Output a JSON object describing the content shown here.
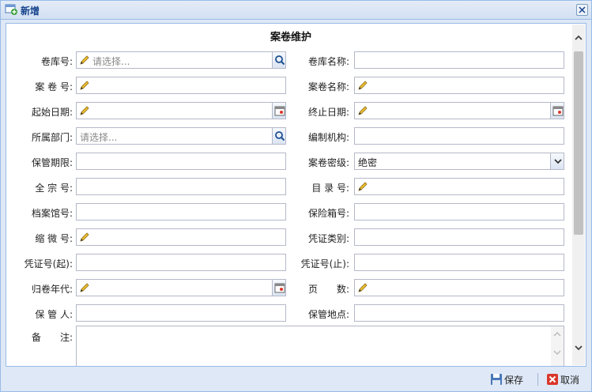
{
  "window": {
    "title": "新增",
    "title_icon": "window-add-icon",
    "close_icon": "close-icon"
  },
  "form": {
    "title": "案卷维护",
    "left": [
      {
        "label": "卷库号:",
        "type": "search",
        "placeholder": "请选择...",
        "pencil": true
      },
      {
        "label": "案 卷 号:",
        "type": "text",
        "value": "",
        "pencil": true
      },
      {
        "label": "起始日期:",
        "type": "date",
        "value": "",
        "pencil": true
      },
      {
        "label": "所属部门:",
        "type": "search",
        "placeholder": "请选择...",
        "pencil": false
      },
      {
        "label": "保管期限:",
        "type": "text",
        "value": "",
        "pencil": false
      },
      {
        "label": "全 宗 号:",
        "type": "text",
        "value": "",
        "pencil": false
      },
      {
        "label": "档案馆号:",
        "type": "text",
        "value": "",
        "pencil": false
      },
      {
        "label": "缩 微 号:",
        "type": "text",
        "value": "",
        "pencil": true
      },
      {
        "label": "凭证号(起):",
        "type": "text",
        "value": "",
        "pencil": false
      },
      {
        "label": "归卷年代:",
        "type": "date",
        "value": "",
        "pencil": true
      },
      {
        "label": "保 管 人:",
        "type": "text",
        "value": "",
        "pencil": false
      }
    ],
    "right": [
      {
        "label": "卷库名称:",
        "type": "text",
        "value": "",
        "pencil": false
      },
      {
        "label": "案卷名称:",
        "type": "text",
        "value": "",
        "pencil": true
      },
      {
        "label": "终止日期:",
        "type": "date",
        "value": "",
        "pencil": true
      },
      {
        "label": "编制机构:",
        "type": "text",
        "value": "",
        "pencil": false
      },
      {
        "label": "案卷密级:",
        "type": "select",
        "value": "绝密",
        "pencil": false
      },
      {
        "label": "目 录 号:",
        "type": "text",
        "value": "",
        "pencil": true
      },
      {
        "label": "保险箱号:",
        "type": "text",
        "value": "",
        "pencil": false
      },
      {
        "label": "凭证类别:",
        "type": "text",
        "value": "",
        "pencil": false
      },
      {
        "label": "凭证号(止):",
        "type": "text",
        "value": "",
        "pencil": false
      },
      {
        "label": "页　　数:",
        "type": "text",
        "value": "",
        "pencil": true
      },
      {
        "label": "保管地点:",
        "type": "text",
        "value": "",
        "pencil": false
      }
    ],
    "remark_label": "备　　注:",
    "remark_value": ""
  },
  "footer": {
    "save_label": "保存",
    "cancel_label": "取消"
  },
  "colors": {
    "title_text": "#15428b",
    "border": "#99bbe8",
    "header_bg": "#dfe8f6"
  }
}
